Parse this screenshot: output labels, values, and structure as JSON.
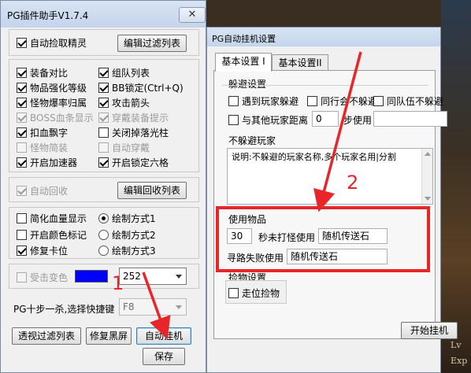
{
  "window1": {
    "title": "PG插件助手V1.7.4",
    "auto_pickup": {
      "label": "自动捡取精灵",
      "checked": true
    },
    "edit_filter_button": "编辑过滤列表",
    "options": [
      {
        "label": "装备对比",
        "checked": true,
        "disabled": false
      },
      {
        "label": "组队列表",
        "checked": true,
        "disabled": false
      },
      {
        "label": "物品强化等级",
        "checked": true,
        "disabled": false
      },
      {
        "label": "BB锁定(Ctrl+Q)",
        "checked": true,
        "disabled": false
      },
      {
        "label": "怪物爆率归属",
        "checked": true,
        "disabled": false
      },
      {
        "label": "攻击箭头",
        "checked": true,
        "disabled": false
      },
      {
        "label": "BOSS血条显示",
        "checked": true,
        "disabled": true
      },
      {
        "label": "穿戴装备提示",
        "checked": true,
        "disabled": true
      },
      {
        "label": "扣血飘字",
        "checked": true,
        "disabled": false
      },
      {
        "label": "关闭掉落光柱",
        "checked": false,
        "disabled": false
      },
      {
        "label": "怪物简装",
        "checked": false,
        "disabled": true
      },
      {
        "label": "自动穿戴",
        "checked": false,
        "disabled": true
      },
      {
        "label": "开启加速器",
        "checked": true,
        "disabled": false
      },
      {
        "label": "开启锁定六格",
        "checked": true,
        "disabled": false
      }
    ],
    "auto_recycle": {
      "label": "自动回收",
      "checked": true,
      "disabled": true
    },
    "edit_recycle_button": "编辑回收列表",
    "display_options": [
      {
        "label": "简化血量显示",
        "checked": false
      },
      {
        "label": "开启颜色标记",
        "checked": false
      },
      {
        "label": "修复卡位",
        "checked": true
      }
    ],
    "draw_modes": [
      {
        "label": "绘制方式1",
        "selected": true
      },
      {
        "label": "绘制方式2",
        "selected": false
      },
      {
        "label": "绘制方式3",
        "selected": false
      }
    ],
    "hit_color": {
      "label": "受击变色",
      "checked": false,
      "disabled": true,
      "color": "#0000ff",
      "value": "252"
    },
    "hotkey": {
      "label": "PG十步一杀,选择快捷键",
      "value": "F8"
    },
    "buttons": {
      "filter_list": "透视过滤列表",
      "repair_black": "修复黑屏",
      "auto_hook": "自动挂机",
      "save": "保存",
      "close": "✕"
    }
  },
  "window2": {
    "title": "PG自动挂机设置",
    "tabs": [
      "基本设置 I",
      "基本设置II"
    ],
    "avoid": {
      "title": "躲避设置",
      "avoid_escape": {
        "label": "遇到玩家躲避",
        "checked": false
      },
      "guild_no_avoid": {
        "label": "同行会不躲避",
        "checked": false
      },
      "team_no_avoid": {
        "label": "同队伍不躲避",
        "checked": false
      },
      "distance": {
        "label": "与其他玩家距离",
        "checked": false,
        "value": "0",
        "suffix": "步使用",
        "item": ""
      }
    },
    "no_avoid": {
      "title": "不躲避玩家",
      "note": "说明:不躲避的玩家名称,多个玩家名用|分割"
    },
    "use_items": {
      "title": "使用物品",
      "seconds_value": "30",
      "seconds_label": "秒未打怪使用",
      "seconds_item": "随机传送石",
      "path_fail_label": "寻路失败使用",
      "path_fail_item": "随机传送石"
    },
    "pickup": {
      "title": "捡物设置",
      "walk_pickup": {
        "label": "走位捡物",
        "checked": false
      }
    },
    "start_button": "开始挂机",
    "close": "✕"
  },
  "annotations": {
    "label1": "1",
    "label2": "2",
    "color": "#e8262a"
  },
  "game": {
    "lv": "Lv",
    "exp": "Exp"
  }
}
